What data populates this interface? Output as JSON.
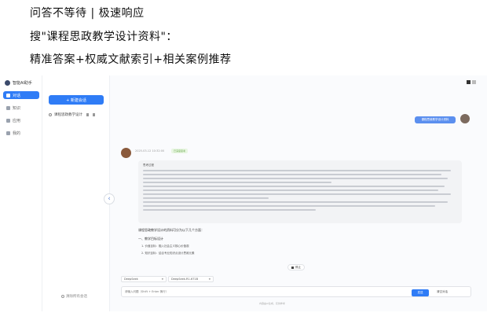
{
  "headlines": {
    "line1": "问答不等待 | 极速响应",
    "line2": "搜\"课程思政教学设计资料\"：",
    "line3": "精准答案+权威文献索引+相关案例推荐"
  },
  "app": {
    "brand": "智能AI助手",
    "nav": [
      {
        "label": "对话",
        "icon": "chat-icon"
      },
      {
        "label": "知识",
        "icon": "book-icon"
      },
      {
        "label": "应用",
        "icon": "grid-icon"
      },
      {
        "label": "我的",
        "icon": "user-icon"
      }
    ],
    "new_chat_label": "+ 新建会话",
    "conversation_title": "课程思政教学设计",
    "footer_label": "清除所有会话"
  },
  "chat": {
    "user_message": "课程思政教学设计资料",
    "bot_time": "2025-03-12 10:32:00",
    "bot_badge": "已深度思考",
    "thinking_title": "思考过程",
    "answer_intro": "课程思政教学设计的资料可分为以下几个方面：",
    "section_heading": "一、教学目标设计",
    "bullets": [
      "1. 价值目标：融入社会主义核心价值观",
      "2. 知识目标：结合专业知识点设计思政元素"
    ],
    "stop_label": "停止"
  },
  "composer": {
    "model_a": "DeepSeek",
    "model_b": "DeepSeek-R1-671B",
    "placeholder": "请输入问题（Shift + Enter 换行）",
    "send_label": "发送",
    "clear_label": "清空对话",
    "footer_note": "内容由AI生成，仅供参考"
  }
}
